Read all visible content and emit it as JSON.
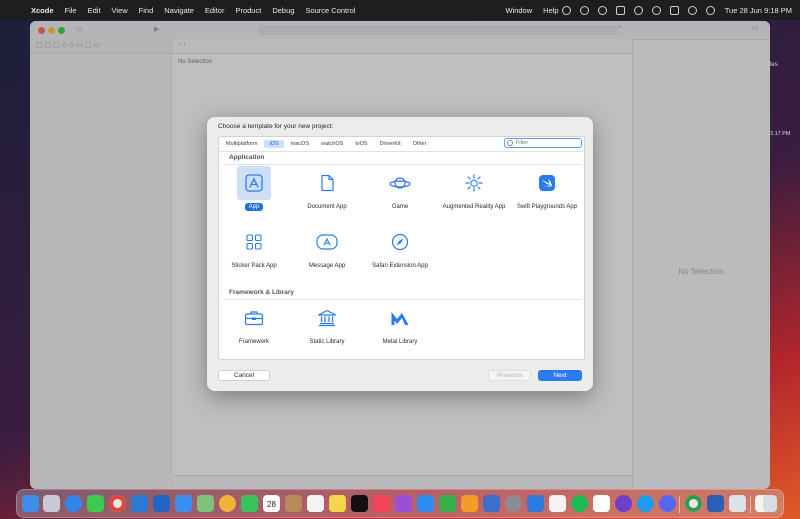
{
  "menubar": {
    "app_name": "Xcode",
    "items": [
      "File",
      "Edit",
      "View",
      "Find",
      "Navigate",
      "Editor",
      "Product",
      "Debug",
      "Source Control",
      "Window",
      "Help"
    ],
    "datetime": "Tue 28 Jun  9:18 PM"
  },
  "desktop": {
    "file_label": "les",
    "time_label": "3.17 PM"
  },
  "xcode": {
    "editor_status": "No Selection",
    "inspector_status": "No Selection"
  },
  "dialog": {
    "title": "Choose a template for your new project:",
    "tabs": [
      "Multiplatform",
      "iOS",
      "macOS",
      "watchOS",
      "tvOS",
      "DriverKit",
      "Other"
    ],
    "active_tab": "iOS",
    "filter_placeholder": "Filter",
    "sections": {
      "application": {
        "label": "Application",
        "templates": [
          "App",
          "Document App",
          "Game",
          "Augmented Reality App",
          "Swift Playgrounds App",
          "Sticker Pack App",
          "Message App",
          "Safari Extension App"
        ]
      },
      "framework": {
        "label": "Framework & Library",
        "templates": [
          "Framework",
          "Static Library",
          "Metal Library"
        ]
      }
    },
    "selected_template": "App",
    "buttons": {
      "cancel": "Cancel",
      "previous": "Previous",
      "next": "Next"
    },
    "accent_color": "#2a7bf0"
  },
  "dock": {
    "items": [
      "finder-icon",
      "launchpad-icon",
      "safari-icon",
      "messages-icon",
      "chrome-icon",
      "vscode-icon",
      "sourcetree-icon",
      "mail-icon",
      "maps-icon",
      "photos-icon",
      "facetime-icon",
      "calendar-icon",
      "contacts-icon",
      "reminders-icon",
      "notes-icon",
      "appletv-icon",
      "music-icon",
      "podcasts-icon",
      "appstore-icon",
      "numbers-icon",
      "pages-icon",
      "system-preferences-icon",
      "xcode-icon",
      "slack-icon",
      "spotify-icon",
      "notion-icon",
      "github-icon",
      "twitter-icon",
      "discord-icon",
      "chrome-icon",
      "word-icon",
      "preview-icon",
      "document-icon",
      "trash-icon"
    ],
    "calendar_day": "28"
  }
}
